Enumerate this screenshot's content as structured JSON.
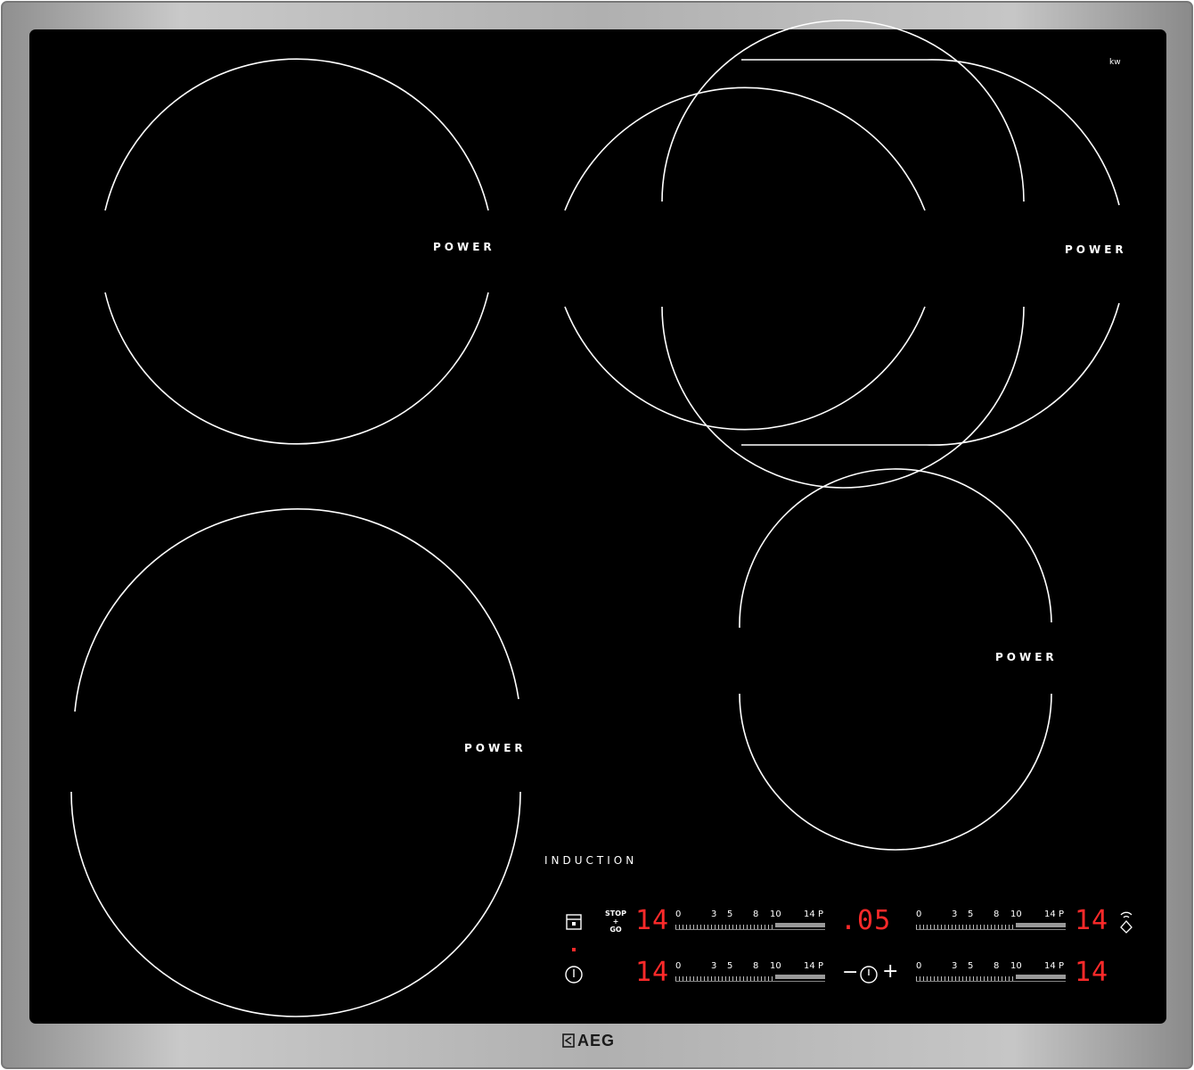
{
  "hob": {
    "brand": "AEG",
    "induction_label": "INDUCTION",
    "kw_mark": "kw",
    "zones": [
      {
        "id": "rear-left",
        "label": "POWER"
      },
      {
        "id": "rear-right-bridge",
        "label": "POWER"
      },
      {
        "id": "front-left",
        "label": "POWER"
      },
      {
        "id": "front-right",
        "label": "POWER"
      }
    ]
  },
  "controls": {
    "stop_go": [
      "STOP",
      "+",
      "GO"
    ],
    "timer_display": ".05",
    "minus_symbol": "−",
    "plus_symbol": "+",
    "displays": {
      "front_left": "14",
      "rear_left": "14",
      "front_right": "14",
      "rear_right": "14"
    },
    "scale_labels": [
      "0",
      "3",
      "5",
      "8",
      "10",
      "14",
      "P"
    ]
  },
  "icons": [
    "child-lock-icon",
    "power-icon",
    "timer-icon",
    "hob2hood-icon",
    "aeg-logo-icon"
  ],
  "colors": {
    "glass": "#000000",
    "display": "#ff2a2a",
    "frame": "#b4b4b4",
    "line": "#ffffff"
  }
}
